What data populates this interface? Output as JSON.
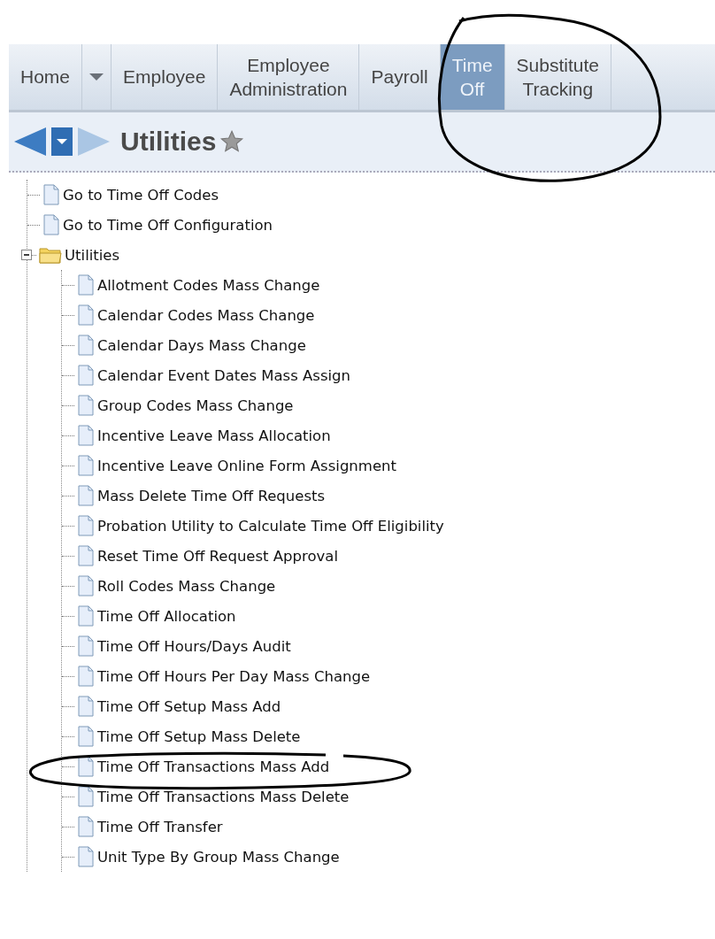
{
  "nav_tabs": [
    {
      "kind": "tab",
      "label": "Home",
      "selected": false
    },
    {
      "kind": "dropdown",
      "selected": false
    },
    {
      "kind": "tab",
      "label": "Employee",
      "selected": false
    },
    {
      "kind": "tab",
      "label": "Employee Administration",
      "selected": false
    },
    {
      "kind": "tab",
      "label": "Payroll",
      "selected": false
    },
    {
      "kind": "tab",
      "label": "Time Off",
      "selected": true
    },
    {
      "kind": "tab",
      "label": "Substitute Tracking",
      "selected": false
    }
  ],
  "page_title": "Utilities",
  "tree": [
    {
      "kind": "page",
      "label": "Go to Time Off Codes"
    },
    {
      "kind": "page",
      "label": "Go to Time Off Configuration"
    },
    {
      "kind": "folder",
      "label": "Utilities",
      "expanded": true,
      "children": [
        {
          "kind": "page",
          "label": "Allotment Codes Mass Change"
        },
        {
          "kind": "page",
          "label": "Calendar Codes Mass Change"
        },
        {
          "kind": "page",
          "label": "Calendar Days Mass Change"
        },
        {
          "kind": "page",
          "label": "Calendar Event Dates Mass Assign"
        },
        {
          "kind": "page",
          "label": "Group Codes Mass Change"
        },
        {
          "kind": "page",
          "label": "Incentive Leave Mass Allocation"
        },
        {
          "kind": "page",
          "label": "Incentive Leave Online Form Assignment"
        },
        {
          "kind": "page",
          "label": "Mass Delete Time Off Requests"
        },
        {
          "kind": "page",
          "label": "Probation Utility to Calculate Time Off Eligibility"
        },
        {
          "kind": "page",
          "label": "Reset Time Off Request Approval"
        },
        {
          "kind": "page",
          "label": "Roll Codes Mass Change"
        },
        {
          "kind": "page",
          "label": "Time Off Allocation"
        },
        {
          "kind": "page",
          "label": "Time Off Hours/Days Audit"
        },
        {
          "kind": "page",
          "label": "Time Off Hours Per Day Mass Change"
        },
        {
          "kind": "page",
          "label": "Time Off Setup Mass Add"
        },
        {
          "kind": "page",
          "label": "Time Off Setup Mass Delete"
        },
        {
          "kind": "page",
          "label": "Time Off Transactions Mass Add"
        },
        {
          "kind": "page",
          "label": "Time Off Transactions Mass Delete"
        },
        {
          "kind": "page",
          "label": "Time Off Transfer"
        },
        {
          "kind": "page",
          "label": "Unit Type By Group Mass Change"
        }
      ]
    }
  ]
}
